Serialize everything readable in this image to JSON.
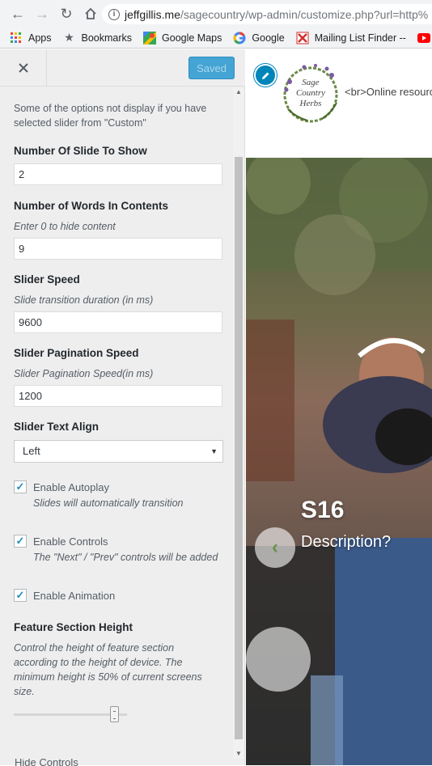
{
  "browser": {
    "url_host": "jeffgillis.me",
    "url_path": "/sagecountry/wp-admin/customize.php?url=http%",
    "bookmarks": [
      {
        "label": "Apps",
        "icon": "apps-grid-icon"
      },
      {
        "label": "Bookmarks",
        "icon": "star-icon"
      },
      {
        "label": "Google Maps",
        "icon": "google-maps-icon"
      },
      {
        "label": "Google",
        "icon": "google-icon"
      },
      {
        "label": "Mailing List Finder --",
        "icon": "mailing-list-icon"
      },
      {
        "label": "Y",
        "icon": "youtube-icon"
      }
    ]
  },
  "panel": {
    "saved_label": "Saved",
    "note": "Some of the options not display if you have selected slider from \"Custom\"",
    "slides_to_show": {
      "label": "Number Of Slide To Show",
      "value": "2"
    },
    "words_in_contents": {
      "label": "Number of Words In Contents",
      "description": "Enter 0 to hide content",
      "value": "9"
    },
    "slider_speed": {
      "label": "Slider Speed",
      "description": "Slide transition duration (in ms)",
      "value": "9600"
    },
    "pagination_speed": {
      "label": "Slider Pagination Speed",
      "description": "Slider Pagination Speed(in ms)",
      "value": "1200"
    },
    "text_align": {
      "label": "Slider Text Align",
      "value": "Left"
    },
    "autoplay": {
      "label": "Enable Autoplay",
      "description": "Slides will automatically transition",
      "checked": true
    },
    "controls": {
      "label": "Enable Controls",
      "description": "The \"Next\" / \"Prev\" controls will be added",
      "checked": true
    },
    "animation": {
      "label": "Enable Animation",
      "checked": true
    },
    "feature_height": {
      "label": "Feature Section Height",
      "description": "Control the height of feature section according to the height of device. The minimum height is 50% of current screens size.",
      "slider_fraction": 0.92
    },
    "hide_controls_label": "Hide Controls"
  },
  "preview": {
    "header_text": "<br>Online resourc",
    "logo_text": [
      "Sage",
      "Country",
      "Herbs"
    ],
    "slide_title": "S16",
    "slide_description": "Description?"
  },
  "colors": {
    "saved_button": "#44a4d4",
    "checkbox_check": "#1e8cbe",
    "edit_pencil": "#0085ba"
  }
}
